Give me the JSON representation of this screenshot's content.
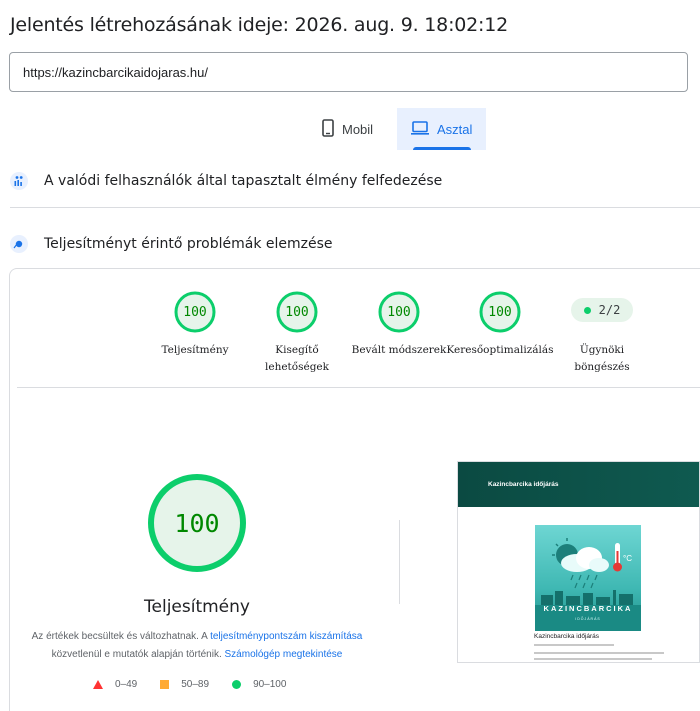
{
  "report": {
    "title": "Jelentés létrehozásának ideje: 2026. aug. 9. 18:02:12",
    "url": "https://kazincbarcikaidojaras.hu/"
  },
  "device_tabs": [
    {
      "label": "Mobil",
      "icon": "smartphone-icon",
      "selected": false
    },
    {
      "label": "Asztal",
      "icon": "laptop-icon",
      "selected": true
    }
  ],
  "sections": {
    "field_data": "A valódi felhasználók által tapasztalt élmény felfedezése",
    "diagnose": "Teljesítményt érintő problémák elemzése"
  },
  "categories": [
    {
      "score": "100",
      "label": "Teljesítmény",
      "score_fraction": 1.0
    },
    {
      "score": "100",
      "label_line1": "Kisegítő",
      "label_line2": "lehetőségek",
      "score_fraction": 1.0
    },
    {
      "score": "100",
      "label": "Bevált módszerek",
      "score_fraction": 1.0
    },
    {
      "score": "100",
      "label": "Keresőoptimalizálás",
      "score_fraction": 1.0
    }
  ],
  "agent": {
    "value": "2/2",
    "label_line1": "Ügynöki",
    "label_line2": "böngészés"
  },
  "performance": {
    "score": "100",
    "score_fraction": 1.0,
    "title": "Teljesítmény",
    "desc_part1": "Az értékek becsültek és változhatnak. A ",
    "desc_link1": "teljesítménypontszám kiszámítása",
    "desc_part2": "közvetlenül e mutatók alapján történik. ",
    "desc_link2": "Számológép megtekintése"
  },
  "legend": {
    "fail": "0–49",
    "average": "50–89",
    "pass": "90–100"
  },
  "preview": {
    "header": "Kazincbarcika időjárás",
    "brand": "KAZINCBARCIKA",
    "brand_sub": "IDŐJÁRÁS",
    "title": "Kazincbarcika időjárás",
    "temp_unit": "°C"
  },
  "colors": {
    "pass": "#0cce6b",
    "pass_text": "#008800",
    "pass_bg": "#e6f4ea",
    "average": "#ffaa33",
    "fail": "#ff3333",
    "accent": "#1a73e8"
  }
}
